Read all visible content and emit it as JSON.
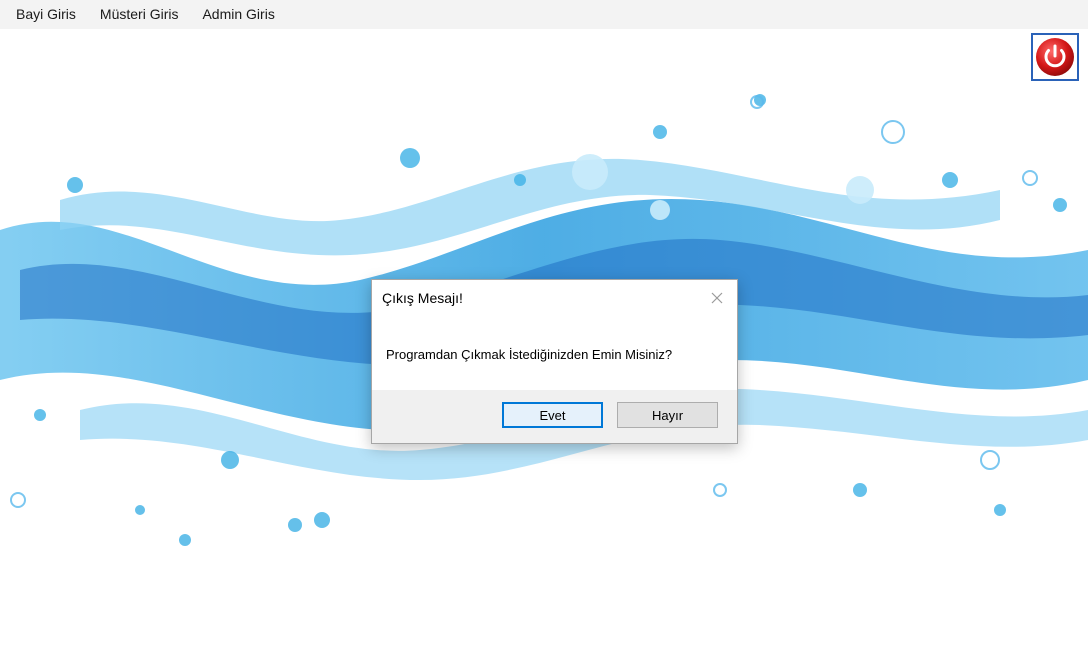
{
  "menu": {
    "items": [
      "Bayi Giris",
      "Müsteri Giris",
      "Admin Giris"
    ]
  },
  "power_button": {
    "icon": "power-icon",
    "color": "#d11a1a"
  },
  "dialog": {
    "title": "Çıkış Mesajı!",
    "message": "Programdan Çıkmak İstediğinizden Emin Misiniz?",
    "yes_label": "Evet",
    "no_label": "Hayır"
  },
  "colors": {
    "accent": "#0078d7",
    "splash_light": "#8fd3f4",
    "splash_mid": "#3fb1e6",
    "splash_dark": "#1f6fc4"
  }
}
